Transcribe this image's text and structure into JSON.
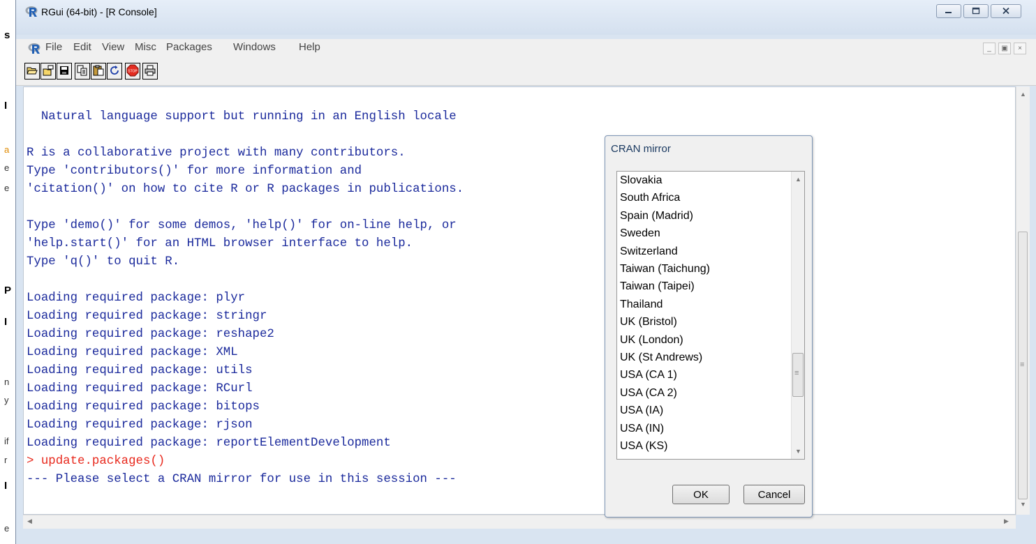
{
  "window": {
    "title": "RGui (64-bit) - [R Console]",
    "app_icon": "r-logo-icon"
  },
  "caption_buttons": [
    "minimize-icon",
    "restore-icon",
    "close-icon"
  ],
  "menubar": {
    "items": [
      "File",
      "Edit",
      "View",
      "Misc",
      "Packages",
      "Windows",
      "Help"
    ]
  },
  "toolbar": {
    "buttons": [
      "open-script-icon",
      "load-workspace-icon",
      "save-icon",
      "copy-icon",
      "paste-icon",
      "refresh-icon",
      "stop-icon",
      "print-icon"
    ]
  },
  "console": {
    "lines": [
      {
        "text": "  Natural language support but running in an English locale"
      },
      {
        "text": ""
      },
      {
        "text": "R is a collaborative project with many contributors."
      },
      {
        "text": "Type 'contributors()' for more information and"
      },
      {
        "text": "'citation()' on how to cite R or R packages in publications."
      },
      {
        "text": ""
      },
      {
        "text": "Type 'demo()' for some demos, 'help()' for on-line help, or"
      },
      {
        "text": "'help.start()' for an HTML browser interface to help."
      },
      {
        "text": "Type 'q()' to quit R."
      },
      {
        "text": ""
      },
      {
        "text": "Loading required package: plyr"
      },
      {
        "text": "Loading required package: stringr"
      },
      {
        "text": "Loading required package: reshape2"
      },
      {
        "text": "Loading required package: XML"
      },
      {
        "text": "Loading required package: utils"
      },
      {
        "text": "Loading required package: RCurl"
      },
      {
        "text": "Loading required package: bitops"
      },
      {
        "text": "Loading required package: rjson"
      },
      {
        "text": "Loading required package: reportElementDevelopment"
      },
      {
        "text": "> update.packages()",
        "kind": "input"
      },
      {
        "text": "--- Please select a CRAN mirror for use in this session ---"
      }
    ],
    "colors": {
      "output": "#1b2a9c",
      "input": "#e8281c"
    }
  },
  "dialog": {
    "title": "CRAN mirror",
    "mirrors": [
      "Slovakia",
      "South Africa",
      "Spain (Madrid)",
      "Sweden",
      "Switzerland",
      "Taiwan (Taichung)",
      "Taiwan (Taipei)",
      "Thailand",
      "UK (Bristol)",
      "UK (London)",
      "UK (St Andrews)",
      "USA (CA 1)",
      "USA (CA 2)",
      "USA (IA)",
      "USA (IN)",
      "USA (KS)"
    ],
    "ok_label": "OK",
    "cancel_label": "Cancel"
  }
}
